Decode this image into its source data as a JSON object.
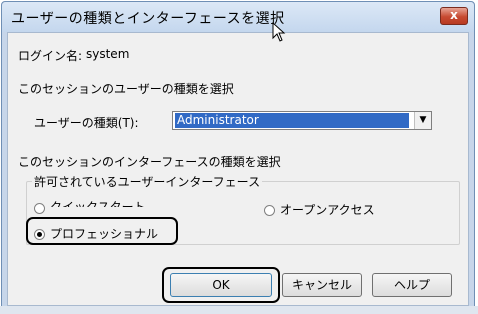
{
  "dialog": {
    "title": "ユーザーの種類とインターフェースを選択",
    "close_label": "x"
  },
  "login": {
    "label": "ログイン名:",
    "value": "system"
  },
  "user_type_section": {
    "heading": "このセッションのユーザーの種類を選択",
    "field_label": "ユーザーの種類(T):",
    "selected_value": "Administrator"
  },
  "interface_section": {
    "heading": "このセッションのインターフェースの種類を選択",
    "group_title": "許可されているユーザーインターフェース",
    "options": [
      {
        "label": "クイックスタート",
        "checked": false
      },
      {
        "label": "オープンアクセス",
        "checked": false
      },
      {
        "label": "プロフェッショナル",
        "checked": true
      }
    ]
  },
  "buttons": {
    "ok": "OK",
    "cancel": "キャンセル",
    "help": "ヘルプ"
  }
}
